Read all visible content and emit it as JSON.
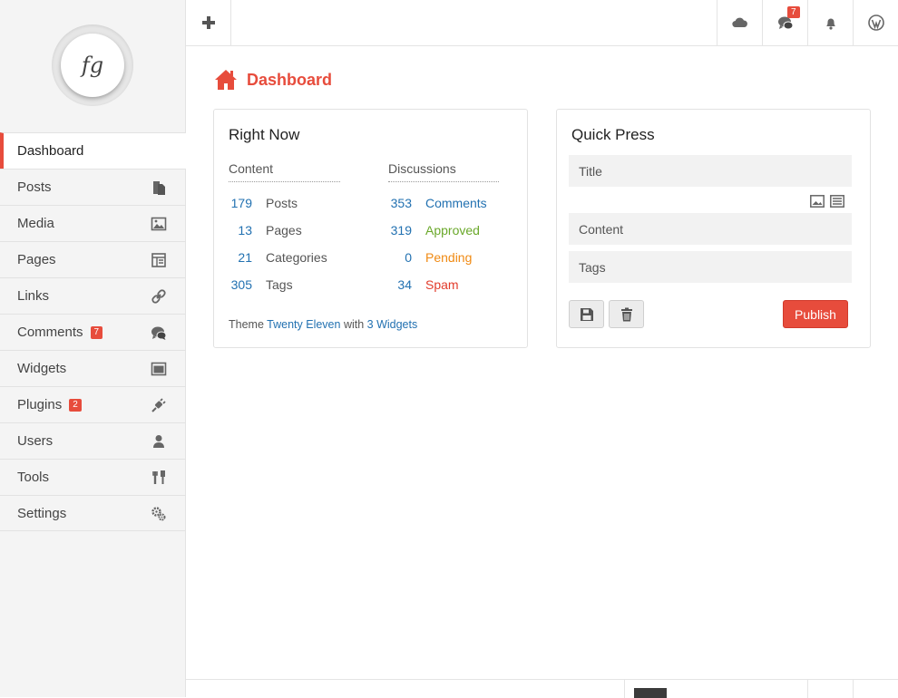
{
  "sidebar": {
    "logo_text": "fg",
    "items": [
      {
        "label": "Dashboard",
        "active": true
      },
      {
        "label": "Posts",
        "icon": "posts-icon"
      },
      {
        "label": "Media",
        "icon": "media-icon"
      },
      {
        "label": "Pages",
        "icon": "pages-icon"
      },
      {
        "label": "Links",
        "icon": "link-icon"
      },
      {
        "label": "Comments",
        "badge": "7",
        "icon": "comments-icon"
      },
      {
        "label": "Widgets",
        "icon": "widgets-icon"
      },
      {
        "label": "Plugins",
        "badge": "2",
        "icon": "plug-icon"
      },
      {
        "label": "Users",
        "icon": "user-icon"
      },
      {
        "label": "Tools",
        "icon": "tools-icon"
      },
      {
        "label": "Settings",
        "icon": "settings-icon"
      }
    ]
  },
  "topbar": {
    "comments_badge": "7",
    "icons": [
      "plus-icon",
      "cloud-icon",
      "comments-icon",
      "bell-icon",
      "wordpress-icon"
    ]
  },
  "page": {
    "title": "Dashboard"
  },
  "right_now": {
    "title": "Right Now",
    "content_head": "Content",
    "discussions_head": "Discussions",
    "content": [
      {
        "num": "179",
        "label": "Posts"
      },
      {
        "num": "13",
        "label": "Pages"
      },
      {
        "num": "21",
        "label": "Categories"
      },
      {
        "num": "305",
        "label": "Tags"
      }
    ],
    "discussions": [
      {
        "num": "353",
        "label": "Comments"
      },
      {
        "num": "319",
        "label": "Approved"
      },
      {
        "num": "0",
        "label": "Pending"
      },
      {
        "num": "34",
        "label": "Spam"
      }
    ],
    "theme_prefix": "Theme",
    "theme_name": "Twenty Eleven",
    "theme_with": "with",
    "widgets_text": "3 Widgets"
  },
  "quick_press": {
    "title": "Quick Press",
    "title_placeholder": "Title",
    "content_placeholder": "Content",
    "tags_placeholder": "Tags",
    "publish_label": "Publish"
  },
  "colors": {
    "accent": "#e74c3c",
    "link": "#2271b1",
    "approved": "#6aa82a",
    "pending": "#f08a13",
    "spam": "#e23c2c"
  }
}
